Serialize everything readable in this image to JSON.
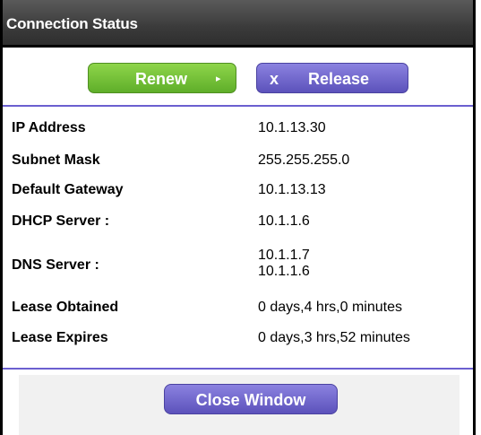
{
  "window": {
    "title": "Connection Status"
  },
  "actions": {
    "renew_label": "Renew",
    "renew_arrow": "▸",
    "release_icon": "x",
    "release_label": "Release",
    "close_label": "Close Window"
  },
  "details": [
    {
      "label": "IP Address",
      "value": "10.1.13.30"
    },
    {
      "label": "Subnet Mask",
      "value": "255.255.255.0"
    },
    {
      "label": "Default Gateway",
      "value": "10.1.13.13"
    },
    {
      "label": "DHCP Server :",
      "value": "10.1.1.6"
    },
    {
      "label": "DNS Server :",
      "values": [
        "10.1.1.7",
        "10.1.1.6"
      ]
    },
    {
      "label": "Lease Obtained",
      "value": "0 days,4 hrs,0 minutes"
    },
    {
      "label": "Lease Expires",
      "value": "0 days,3 hrs,52 minutes"
    }
  ],
  "colors": {
    "renew_green": "#6fbf35",
    "release_purple": "#6b61c8",
    "divider": "#6b5fd0",
    "titlebar": "#3b3b3b"
  },
  "icons": [
    "close-x-icon",
    "play-arrow-icon"
  ]
}
